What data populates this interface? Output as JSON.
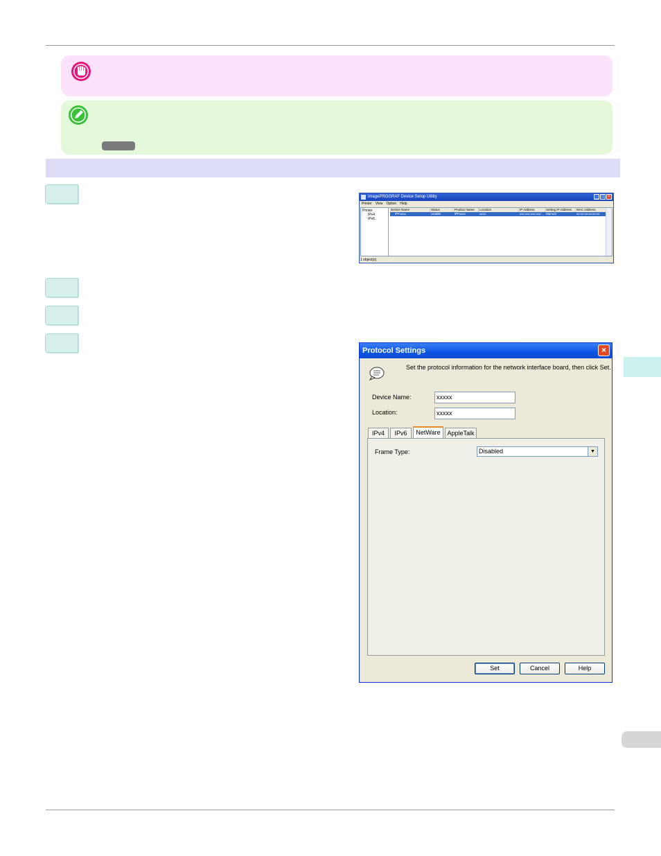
{
  "page": {
    "colors": {
      "important_bg": "#fce3fa",
      "note_bg": "#e3f9d9",
      "section_bar": "#dcdcf7",
      "step_box": "#d6f0ee",
      "side_tab": "#ccf2f0"
    }
  },
  "icons": {
    "important": "hand-stop-icon",
    "note": "pencil-icon"
  },
  "small_window": {
    "title": "imagePROGRAF Device Setup Utility",
    "menu": [
      "Printer",
      "View",
      "Option",
      "Help"
    ],
    "tree": [
      "Printer",
      "IPv4",
      "IPv6"
    ],
    "columns": [
      "Device Name",
      "Status",
      "Product Name",
      "Location",
      "IP Address",
      "Setting IP Address",
      "MAC Address"
    ],
    "row": [
      "iPFxxxx",
      "Usable",
      "iPFxxxx",
      "xxxx",
      "xxx.xxx.xxx.xxx",
      "Manual",
      "xx:xx:xx:xx:xx:xx"
    ],
    "status": "1 object(s)"
  },
  "dialog": {
    "title": "Protocol Settings",
    "instruction": "Set the protocol information for the network interface board, then click Set.",
    "device_name_label": "Device Name:",
    "device_name_value": "xxxxx",
    "location_label": "Location:",
    "location_value": "xxxxx",
    "tabs": [
      "IPv4",
      "IPv6",
      "NetWare",
      "AppleTalk"
    ],
    "active_tab": "NetWare",
    "frame_type_label": "Frame Type:",
    "frame_type_value": "Disabled",
    "buttons": {
      "set": "Set",
      "cancel": "Cancel",
      "help": "Help"
    }
  }
}
